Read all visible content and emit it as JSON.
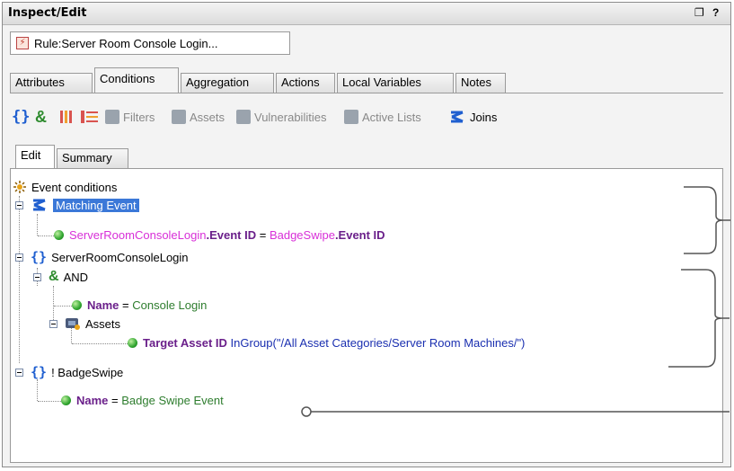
{
  "panel": {
    "title": "Inspect/Edit",
    "controls": [
      "❐",
      "?"
    ]
  },
  "doc_tab": {
    "label": "Rule:Server Room Console Login..."
  },
  "tabs": [
    {
      "label": "Attributes",
      "active": false
    },
    {
      "label": "Conditions",
      "active": true
    },
    {
      "label": "Aggregation",
      "active": false
    },
    {
      "label": "Actions",
      "active": false
    },
    {
      "label": "Local Variables",
      "active": false
    },
    {
      "label": "Notes",
      "active": false
    }
  ],
  "toolbar": {
    "filters": "Filters",
    "assets": "Assets",
    "vulnerabilities": "Vulnerabilities",
    "active_lists": "Active Lists",
    "joins": "Joins"
  },
  "subtabs": [
    {
      "label": "Edit",
      "active": true
    },
    {
      "label": "Summary",
      "active": false
    }
  ],
  "tree": {
    "root": "Event conditions",
    "matching_event": "Matching Event",
    "match_left_event": "ServerRoomConsoleLogin",
    "match_left_field": ".Event ID",
    "match_op": " = ",
    "match_right_event": "BadgeSwipe",
    "match_right_field": ".Event ID",
    "event1": "ServerRoomConsoleLogin",
    "and": "AND",
    "name_field": "Name",
    "eq": " = ",
    "console_login": "Console Login",
    "assets": "Assets",
    "target_asset": "Target Asset ID",
    "ingroup": " InGroup(\"/All Asset Categories/Server Room Machines/\")",
    "event2": "! BadgeSwipe",
    "badge_swipe_event": "Badge Swipe Event"
  },
  "colors": {
    "brace_blue": "#1f5fd0",
    "and_green": "#2e8b2e",
    "event_magenta": "#d82fd8",
    "field_purple": "#6a1f8a",
    "value_green": "#2e7d2e",
    "selection_blue": "#3b78d8"
  }
}
